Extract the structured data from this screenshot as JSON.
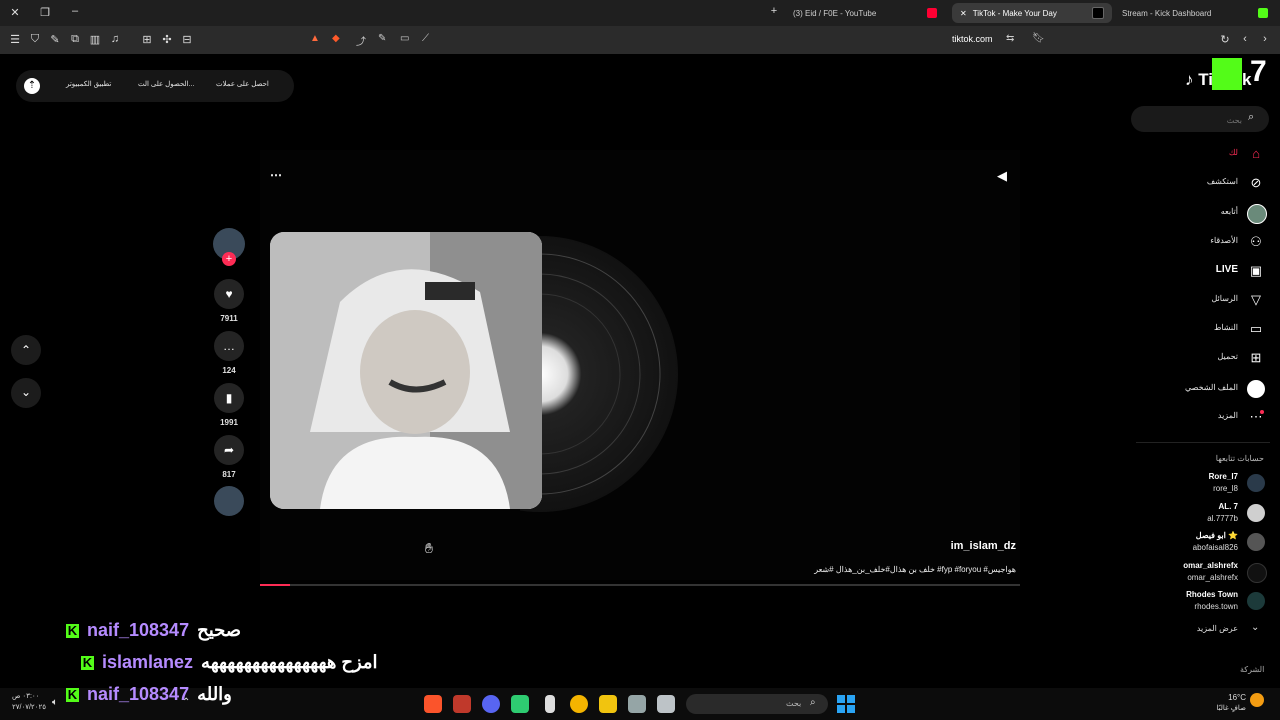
{
  "tabs": [
    {
      "title": "(3) Eid / F0E - YouTube"
    },
    {
      "title": "TikTok - Make Your Day"
    },
    {
      "title": "Stream - Kick Dashboard"
    }
  ],
  "address": {
    "url": "tiktok.com"
  },
  "top_pill": {
    "coins": "احصل على عملات",
    "get_app": "الحصول على الت...",
    "desktop_app": "تطبيق الكمبيوتر"
  },
  "search": {
    "placeholder": "بحث"
  },
  "nav": [
    {
      "label": "لك"
    },
    {
      "label": "استكشف"
    },
    {
      "label": "أتابعه"
    },
    {
      "label": "الأصدقاء"
    },
    {
      "label": "LIVE"
    },
    {
      "label": "الرسائل"
    },
    {
      "label": "النشاط"
    },
    {
      "label": "تحميل"
    },
    {
      "label": "الملف الشخصي"
    },
    {
      "label": "المزيد"
    }
  ],
  "following_title": "حسابات تتابعها",
  "following": [
    {
      "name": "Rore_l7",
      "handle": "rore_l8",
      "badge": "SA"
    },
    {
      "name": "AL. 7",
      "handle": "al.7777b"
    },
    {
      "name": "ابو فيصل ⭐",
      "handle": "abofaisal826"
    },
    {
      "name": "omar_alshrefx",
      "handle": "omar_alshrefx"
    },
    {
      "name": "Rhodes Town",
      "handle": "rhodes.town"
    }
  ],
  "see_more": "عرض المزيد",
  "company": "الشركة",
  "video": {
    "username": "im_islam_dz",
    "caption": "خلف بن هذال#خلف_بن_هذال #شعر #fyp #foryou #هواجيس",
    "likes": "7911",
    "comments": "124",
    "saves": "1991",
    "shares": "817",
    "progress": 0.04
  },
  "chat": [
    {
      "user": "naif_108347",
      "message": "صحيح",
      "color": "#b58bff"
    },
    {
      "user": "islamlanez",
      "message": "امزح هههههههههههههههه",
      "color": "#b58bff"
    },
    {
      "user": "naif_108347",
      "message": "والله",
      "color": "#b58bff"
    }
  ],
  "taskbar": {
    "search_placeholder": "بحث",
    "weather_temp": "16°C",
    "weather_desc": "صافٍ غالبًا",
    "time": "٠٣:٠٠ ص",
    "date": "٢٧/٠٧/٢٠٢٥"
  },
  "colors": {
    "accent": "#fe2c55",
    "kick_green": "#53fc18"
  }
}
